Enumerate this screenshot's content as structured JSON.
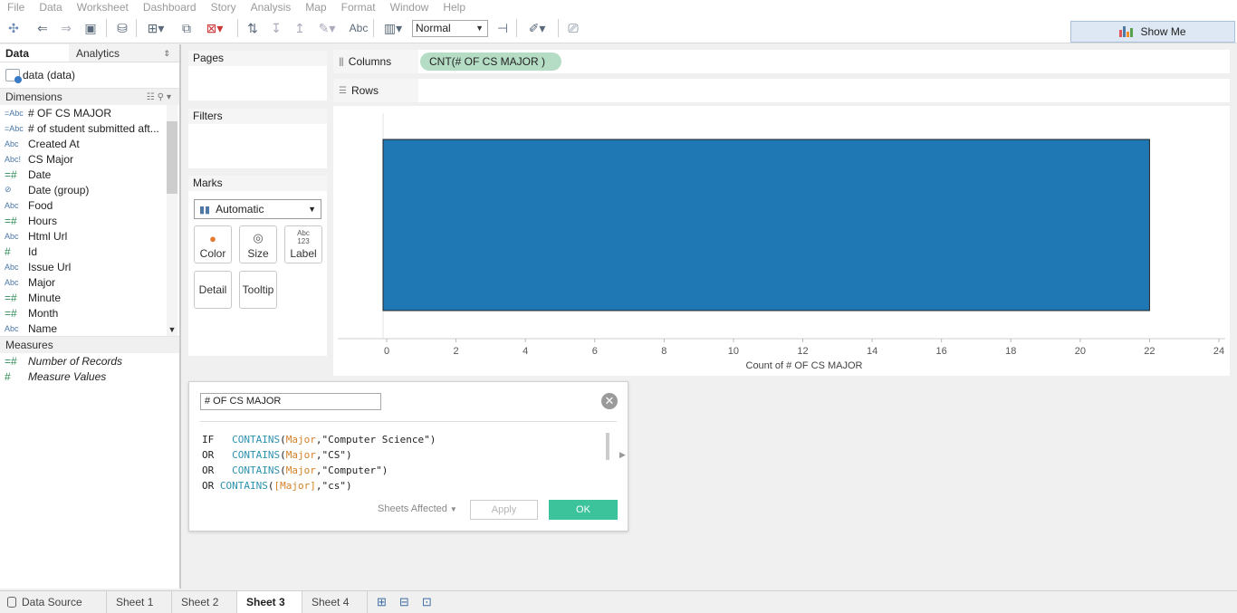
{
  "menu": [
    "File",
    "Data",
    "Worksheet",
    "Dashboard",
    "Story",
    "Analysis",
    "Map",
    "Format",
    "Window",
    "Help"
  ],
  "toolbar": {
    "abc_label": "Abc",
    "fit_value": "Normal",
    "show_me_label": "Show Me",
    "icons": [
      "tableau-logo-icon",
      "undo-icon",
      "redo-icon",
      "save-icon",
      "new-datasource-icon",
      "new-worksheet-icon",
      "duplicate-icon",
      "clear-sheet-icon",
      "swap-icon",
      "sort-ascending-icon",
      "sort-descending-icon",
      "highlight-icon",
      "labels-icon",
      "group-icon",
      "fit-icon",
      "pin-icon",
      "pen-icon",
      "presentation-icon"
    ]
  },
  "left_pane": {
    "tab_data": "Data",
    "tab_analytics": "Analytics",
    "datasource_name": "data (data)",
    "dimensions_label": "Dimensions",
    "dimensions": [
      {
        "type": "=Abc",
        "name": "# OF CS MAJOR"
      },
      {
        "type": "=Abc",
        "name": "# of student submitted aft..."
      },
      {
        "type": "Abc",
        "name": "Created At"
      },
      {
        "type": "Abc!",
        "name": "CS Major"
      },
      {
        "type": "=#",
        "name": "Date"
      },
      {
        "type": "⊘",
        "name": "Date (group)"
      },
      {
        "type": "Abc",
        "name": "Food"
      },
      {
        "type": "=#",
        "name": "Hours"
      },
      {
        "type": "Abc",
        "name": "Html Url"
      },
      {
        "type": "#",
        "name": "Id"
      },
      {
        "type": "Abc",
        "name": "Issue Url"
      },
      {
        "type": "Abc",
        "name": "Major"
      },
      {
        "type": "=#",
        "name": "Minute"
      },
      {
        "type": "=#",
        "name": "Month"
      },
      {
        "type": "Abc",
        "name": "Name"
      }
    ],
    "measures_label": "Measures",
    "measures": [
      {
        "type": "=#",
        "name": "Number of Records"
      },
      {
        "type": "#",
        "name": "Measure Values"
      }
    ]
  },
  "cards": {
    "pages": "Pages",
    "filters": "Filters",
    "marks": "Marks",
    "mark_type": "Automatic",
    "buttons": {
      "color": "Color",
      "size": "Size",
      "label": "Label",
      "detail": "Detail",
      "tooltip": "Tooltip",
      "label_glyph_top": "Abc",
      "label_glyph_bottom": "123"
    }
  },
  "shelves": {
    "columns_label": "Columns",
    "columns_pill": "CNT(# OF CS MAJOR )",
    "rows_label": "Rows"
  },
  "chart_data": {
    "type": "bar",
    "orientation": "horizontal",
    "categories": [
      ""
    ],
    "values": [
      22
    ],
    "xlabel": "Count of # OF CS MAJOR",
    "xlim": [
      0,
      24
    ],
    "x_ticks": [
      0,
      2,
      4,
      6,
      8,
      10,
      12,
      14,
      16,
      18,
      20,
      22,
      24
    ],
    "bar_color": "#1f77b4"
  },
  "calc_dialog": {
    "name": "# OF CS MAJOR",
    "code_lines": [
      [
        {
          "t": "IF   ",
          "c": ""
        },
        {
          "t": "CONTAINS",
          "c": "fn"
        },
        {
          "t": "(",
          "c": ""
        },
        {
          "t": "Major",
          "c": "field"
        },
        {
          "t": ",\"Computer Science\")",
          "c": ""
        }
      ],
      [
        {
          "t": "OR   ",
          "c": ""
        },
        {
          "t": "CONTAINS",
          "c": "fn"
        },
        {
          "t": "(",
          "c": ""
        },
        {
          "t": "Major",
          "c": "field"
        },
        {
          "t": ",\"CS\")",
          "c": ""
        }
      ],
      [
        {
          "t": "OR   ",
          "c": ""
        },
        {
          "t": "CONTAINS",
          "c": "fn"
        },
        {
          "t": "(",
          "c": ""
        },
        {
          "t": "Major",
          "c": "field"
        },
        {
          "t": ",\"Computer\")",
          "c": ""
        }
      ],
      [
        {
          "t": "OR ",
          "c": ""
        },
        {
          "t": "CONTAINS",
          "c": "fn"
        },
        {
          "t": "(",
          "c": ""
        },
        {
          "t": "[Major]",
          "c": "field"
        },
        {
          "t": ",\"cs\")",
          "c": ""
        }
      ]
    ],
    "sheets_affected": "Sheets Affected",
    "apply": "Apply",
    "ok": "OK"
  },
  "bottom_tabs": {
    "datasource": "Data Source",
    "sheets": [
      "Sheet 1",
      "Sheet 2",
      "Sheet 3",
      "Sheet 4"
    ],
    "active": "Sheet 3"
  },
  "colors": {
    "accent": "#3cc39b",
    "pill": "#b5dcc4",
    "bar": "#1f77b4"
  }
}
